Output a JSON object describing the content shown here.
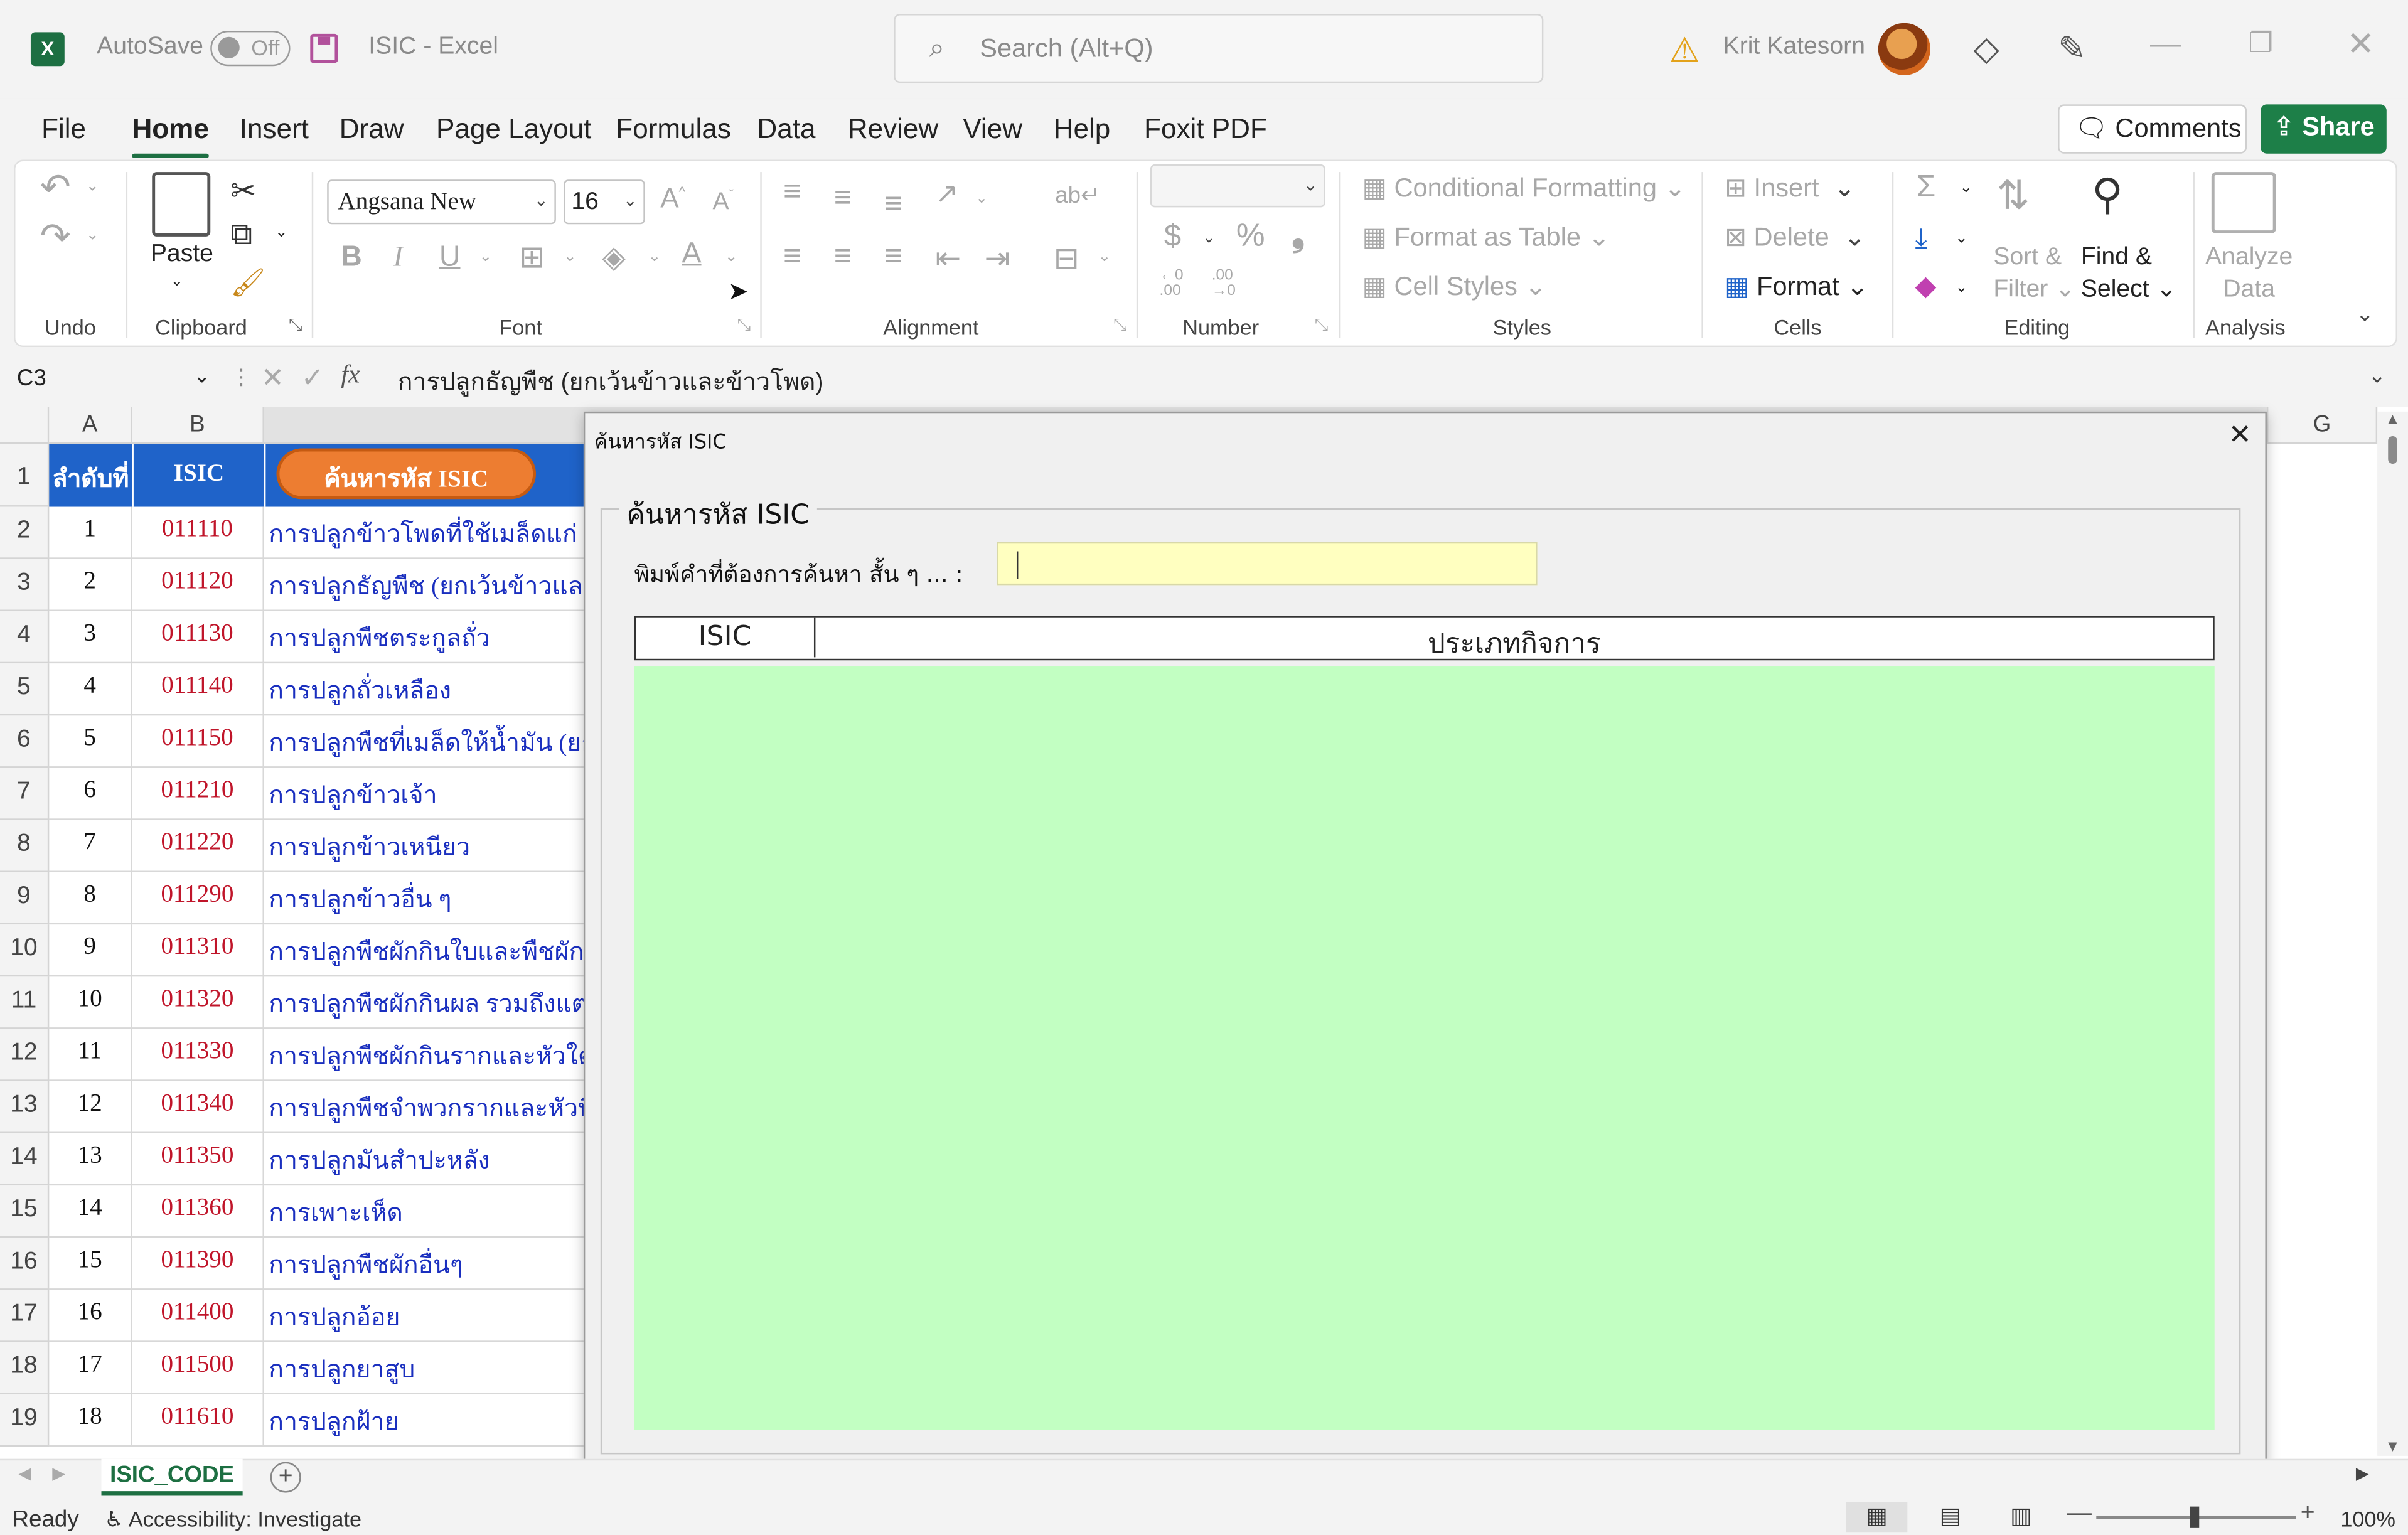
{
  "titlebar": {
    "logo": "X",
    "autosave_label": "AutoSave",
    "autosave_state": "Off",
    "doc_title": "ISIC  -  Excel",
    "search_placeholder": "Search (Alt+Q)",
    "user_name": "Krit Katesorn"
  },
  "menu": {
    "tabs": [
      "File",
      "Home",
      "Insert",
      "Draw",
      "Page Layout",
      "Formulas",
      "Data",
      "Review",
      "View",
      "Help",
      "Foxit PDF"
    ],
    "active": "Home",
    "comments_label": "Comments",
    "share_label": "Share"
  },
  "ribbon": {
    "undo_group": "Undo",
    "clipboard_group": "Clipboard",
    "paste_label": "Paste",
    "font_group": "Font",
    "font_name": "Angsana New",
    "font_size": "16",
    "alignment_group": "Alignment",
    "number_group": "Number",
    "styles_group": "Styles",
    "conditional_formatting": "Conditional Formatting",
    "format_as_table": "Format as Table",
    "cell_styles": "Cell Styles",
    "cells_group": "Cells",
    "insert_label": "Insert",
    "delete_label": "Delete",
    "format_label": "Format",
    "editing_group": "Editing",
    "sort_filter_1": "Sort &",
    "sort_filter_2": "Filter",
    "find_select_1": "Find &",
    "find_select_2": "Select",
    "analysis_group": "Analysis",
    "analyze_data_1": "Analyze",
    "analyze_data_2": "Data"
  },
  "formula_bar": {
    "name_box": "C3",
    "fx": "fx",
    "formula": "การปลูกธัญพืช (ยกเว้นข้าวและข้าวโพด)"
  },
  "sheet": {
    "col_headers": [
      "A",
      "B",
      "G"
    ],
    "header_row": {
      "a": "ลำดับที่",
      "b": "ISIC",
      "c_button": "ค้นหารหัส ISIC"
    },
    "rows": [
      {
        "n": "2",
        "a": "1",
        "b": "011110",
        "c": "การปลูกข้าวโพดที่ใช้เมล็ดแก่"
      },
      {
        "n": "3",
        "a": "2",
        "b": "011120",
        "c": "การปลูกธัญพืช (ยกเว้นข้าวและข้"
      },
      {
        "n": "4",
        "a": "3",
        "b": "011130",
        "c": "การปลูกพืชตระกูลถั่ว"
      },
      {
        "n": "5",
        "a": "4",
        "b": "011140",
        "c": "การปลูกถั่วเหลือง"
      },
      {
        "n": "6",
        "a": "5",
        "b": "011150",
        "c": "การปลูกพืชที่เมล็ดให้น้ำมัน (ยกเ"
      },
      {
        "n": "7",
        "a": "6",
        "b": "011210",
        "c": "การปลูกข้าวเจ้า"
      },
      {
        "n": "8",
        "a": "7",
        "b": "011220",
        "c": "การปลูกข้าวเหนียว"
      },
      {
        "n": "9",
        "a": "8",
        "b": "011290",
        "c": "การปลูกข้าวอื่น ๆ"
      },
      {
        "n": "10",
        "a": "9",
        "b": "011310",
        "c": "การปลูกพืชผักกินใบและพืชผักกิ"
      },
      {
        "n": "11",
        "a": "10",
        "b": "011320",
        "c": "การปลูกพืชผักกินผล รวมถึงแตง"
      },
      {
        "n": "12",
        "a": "11",
        "b": "011330",
        "c": "การปลูกพืชผักกินรากและหัวใต้ดิ"
      },
      {
        "n": "13",
        "a": "12",
        "b": "011340",
        "c": "การปลูกพืชจำพวกรากและหัวที่ใ"
      },
      {
        "n": "14",
        "a": "13",
        "b": "011350",
        "c": "การปลูกมันสำปะหลัง"
      },
      {
        "n": "15",
        "a": "14",
        "b": "011360",
        "c": "การเพาะเห็ด"
      },
      {
        "n": "16",
        "a": "15",
        "b": "011390",
        "c": "การปลูกพืชผักอื่นๆ"
      },
      {
        "n": "17",
        "a": "16",
        "b": "011400",
        "c": "การปลูกอ้อย"
      },
      {
        "n": "18",
        "a": "17",
        "b": "011500",
        "c": "การปลูกยาสูบ"
      },
      {
        "n": "19",
        "a": "18",
        "b": "011610",
        "c": "การปลูกฝ้าย"
      }
    ],
    "row1_label": "1"
  },
  "dialog": {
    "title": "ค้นหารหัส ISIC",
    "frame_caption": "ค้นหารหัส ISIC",
    "search_label": "พิมพ์คำที่ต้องการค้นหา สั้น ๆ ... :",
    "search_value": "",
    "col_isic": "ISIC",
    "col_type": "ประเภทกิจการ"
  },
  "sheet_tabs": {
    "active": "ISIC_CODE"
  },
  "status": {
    "ready": "Ready",
    "accessibility": "Accessibility: Investigate",
    "zoom": "100%"
  },
  "colors": {
    "excel_green": "#1d6f42",
    "header_blue": "#1f63c9",
    "search_yellow": "#ffffc0",
    "results_green": "#c2ffc2",
    "isic_red": "#c0152a",
    "desc_blue": "#1a2fbf",
    "orange_button": "#ed7d31"
  }
}
